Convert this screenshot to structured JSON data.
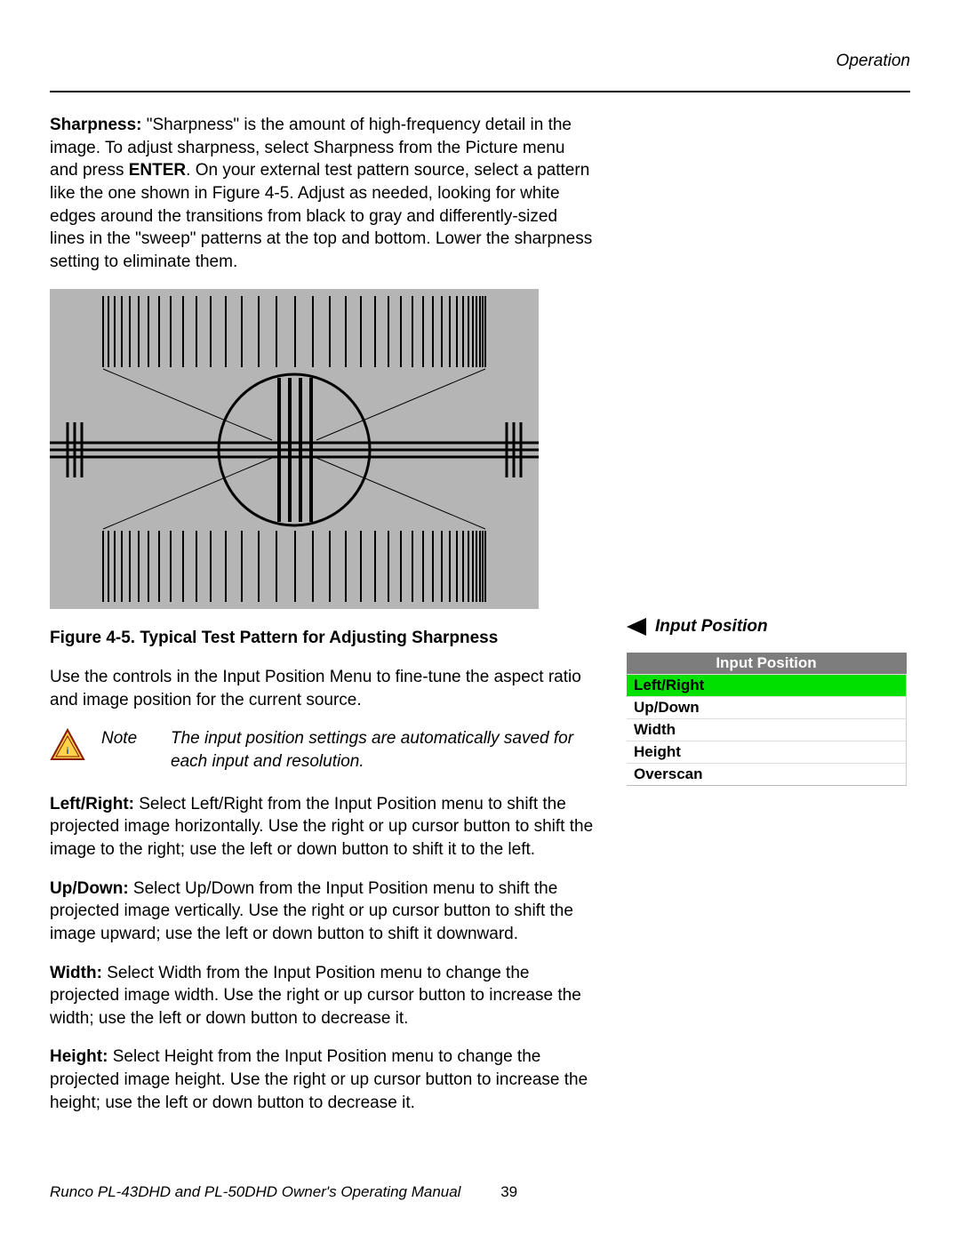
{
  "header": {
    "section": "Operation"
  },
  "sharpness": {
    "label": "Sharpness:",
    "text_before_enter": " \"Sharpness\" is the amount of high-frequency detail in the image. To adjust sharpness, select Sharpness from the Picture menu and press ",
    "enter": "ENTER",
    "text_after_enter": ". On your external test pattern source, select a pattern like the one shown in Figure 4-5. Adjust as needed, looking for white edges around the transitions from black to gray and differently-sized lines in the \"sweep\" patterns at the top and bottom. Lower the sharpness setting to eliminate them."
  },
  "figure": {
    "caption": "Figure 4-5. Typical Test Pattern for Adjusting Sharpness"
  },
  "intro": {
    "text": "Use the controls in the Input Position Menu to fine-tune the aspect ratio and image position for the current source."
  },
  "note": {
    "label": "Note",
    "text": "The input position settings are automatically saved for each input and resolution."
  },
  "leftright": {
    "label": "Left/Right:",
    "text": " Select Left/Right from the Input Position menu to shift the projected image horizontally. Use the right or up cursor button to shift the image to the right; use the left or down button to shift it to the left."
  },
  "updown": {
    "label": "Up/Down:",
    "text": " Select Up/Down from the Input Position menu to shift the projected image vertically. Use the right or up cursor button to shift the image upward; use the left or down button to shift it downward."
  },
  "width": {
    "label": "Width:",
    "text": " Select Width from the Input Position menu to change the projected image width. Use the right or up cursor button to increase the width; use the left or down button to decrease it."
  },
  "height": {
    "label": "Height:",
    "text": " Select Height from the Input Position menu to change the projected image height. Use the right or up cursor button to increase the height; use the left or down button to decrease it."
  },
  "side": {
    "heading": "Input Position",
    "menu": {
      "title": "Input Position",
      "items": [
        "Left/Right",
        "Up/Down",
        "Width",
        "Height",
        "Overscan"
      ],
      "selected_index": 0
    }
  },
  "footer": {
    "manual": "Runco PL-43DHD and PL-50DHD Owner's Operating Manual",
    "page": "39"
  }
}
